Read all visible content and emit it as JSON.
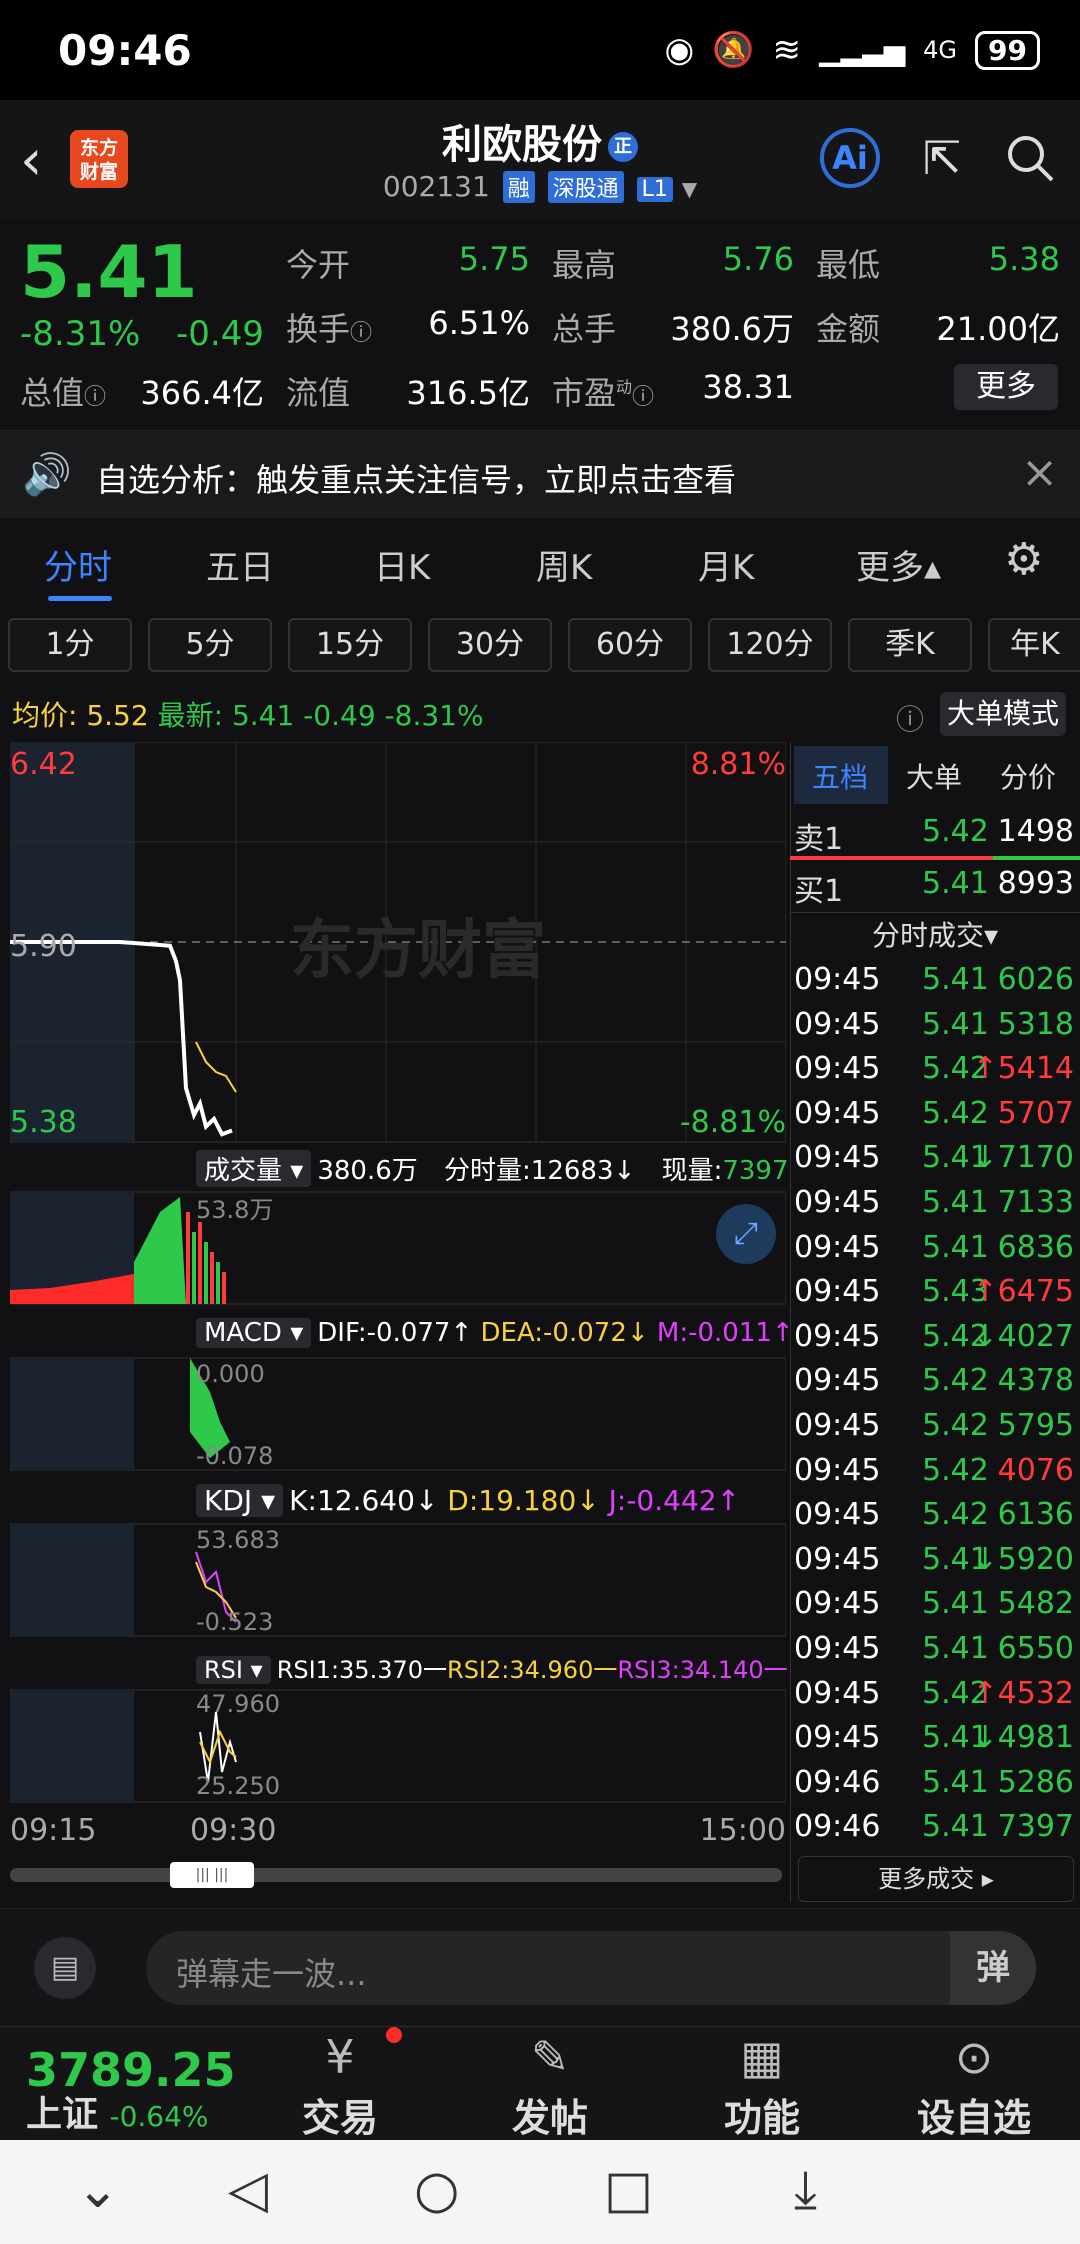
{
  "status": {
    "time": "09:46",
    "battery": "99",
    "network": "4G"
  },
  "header": {
    "logo_line1": "东方",
    "logo_line2": "财富",
    "name": "利欧股份",
    "name_badge": "正",
    "code": "002131",
    "tag_rong": "融",
    "tag_sgt": "深股通",
    "tag_level": "L1",
    "ai_label": "Ai"
  },
  "quote": {
    "price": "5.41",
    "change_pct": "-8.31%",
    "change": "-0.49",
    "open_label": "今开",
    "open": "5.75",
    "high_label": "最高",
    "high": "5.76",
    "low_label": "最低",
    "low": "5.38",
    "turnover_label": "换手",
    "turnover": "6.51%",
    "volume_label": "总手",
    "volume": "380.6万",
    "amount_label": "金额",
    "amount": "21.00亿",
    "mktcap_label": "总值",
    "mktcap": "366.4亿",
    "float_label": "流值",
    "float": "316.5亿",
    "pe_label": "市盈",
    "pe_sup": "动",
    "pe": "38.31",
    "more": "更多"
  },
  "alert": {
    "text": "自选分析：触发重点关注信号，立即点击查看"
  },
  "tabs": [
    "分时",
    "五日",
    "日K",
    "周K",
    "月K",
    "更多▴"
  ],
  "periods": [
    "1分",
    "5分",
    "15分",
    "30分",
    "60分",
    "120分",
    "季K",
    "年K"
  ],
  "avg": {
    "avg_label": "均价:",
    "avg": "5.52",
    "latest_label": "最新:",
    "latest": "5.41",
    "chg": "-0.49",
    "pct": "-8.31%",
    "big_order": "大单模式"
  },
  "chart": {
    "price_top": "6.42",
    "pct_top": "8.81%",
    "price_mid": "5.90",
    "watermark": "东方财富",
    "price_bottom": "5.38",
    "pct_bottom": "-8.81%",
    "vol_label": "成交量",
    "vol_total": "380.6万",
    "vol_period": "分时量:12683↓",
    "vol_now_label": "现量:",
    "vol_now": "7397",
    "vol_max": "53.8万",
    "macd_label": "MACD",
    "macd_dif": "DIF:-0.077↑",
    "macd_dea": "DEA:-0.072↓",
    "macd_m": "M:-0.011↑",
    "macd_top": "0.000",
    "macd_bottom": "-0.078",
    "kdj_label": "KDJ",
    "kdj_k": "K:12.640↓",
    "kdj_d": "D:19.180↓",
    "kdj_j": "J:-0.442↑",
    "kdj_top": "53.683",
    "kdj_bottom": "-0.523",
    "rsi_label": "RSI",
    "rsi1": "RSI1:35.370一",
    "rsi2": "RSI2:34.960一",
    "rsi3": "RSI3:34.140一",
    "rsi_top": "47.960",
    "rsi_bottom": "25.250",
    "time_start": "09:15",
    "time_mid": "09:30",
    "time_end": "15:00"
  },
  "chart_data": {
    "type": "line",
    "title": "",
    "ylim": [
      5.38,
      6.42
    ],
    "xlabel": "",
    "ylabel": "",
    "x": [
      "09:15",
      "09:30",
      "15:00"
    ],
    "series": [
      {
        "values": [
          5.9,
          5.9,
          5.89,
          5.85,
          5.8,
          5.52,
          5.45,
          5.48,
          5.42,
          5.44,
          5.4,
          5.41
        ]
      }
    ]
  },
  "panel": {
    "tabs": [
      "五档",
      "大单",
      "分价"
    ],
    "sell1_label": "卖1",
    "sell1_price": "5.42",
    "sell1_vol": "1498",
    "buy1_label": "买1",
    "buy1_price": "5.41",
    "buy1_vol": "8993",
    "ticks_title": "分时成交▾",
    "ticks": [
      [
        "09:45",
        "5.41",
        "6026",
        "g"
      ],
      [
        "09:45",
        "5.41",
        "5318",
        "g"
      ],
      [
        "09:45",
        "5.42",
        "↑5414",
        "r"
      ],
      [
        "09:45",
        "5.42",
        "5707",
        "r"
      ],
      [
        "09:45",
        "5.41",
        "↓7170",
        "g"
      ],
      [
        "09:45",
        "5.41",
        "7133",
        "g"
      ],
      [
        "09:45",
        "5.41",
        "6836",
        "g"
      ],
      [
        "09:45",
        "5.43",
        "↑6475",
        "r"
      ],
      [
        "09:45",
        "5.42",
        "↓4027",
        "g"
      ],
      [
        "09:45",
        "5.42",
        "4378",
        "g"
      ],
      [
        "09:45",
        "5.42",
        "5795",
        "g"
      ],
      [
        "09:45",
        "5.42",
        "4076",
        "r"
      ],
      [
        "09:45",
        "5.42",
        "6136",
        "g"
      ],
      [
        "09:45",
        "5.41",
        "↓5920",
        "g"
      ],
      [
        "09:45",
        "5.41",
        "5482",
        "g"
      ],
      [
        "09:45",
        "5.41",
        "6550",
        "g"
      ],
      [
        "09:45",
        "5.42",
        "↑4532",
        "r"
      ],
      [
        "09:45",
        "5.41",
        "↓4981",
        "g"
      ],
      [
        "09:46",
        "5.41",
        "5286",
        "g"
      ],
      [
        "09:46",
        "5.41",
        "7397",
        "g"
      ]
    ],
    "more_ticks": "更多成交 ▸"
  },
  "comment": {
    "placeholder": "弹幕走一波...",
    "danmu": "弹"
  },
  "bottom": {
    "index_value": "3789.25",
    "index_name": "上证",
    "index_pct": "-0.64%",
    "nav": [
      "交易",
      "发帖",
      "功能",
      "设自选"
    ]
  }
}
